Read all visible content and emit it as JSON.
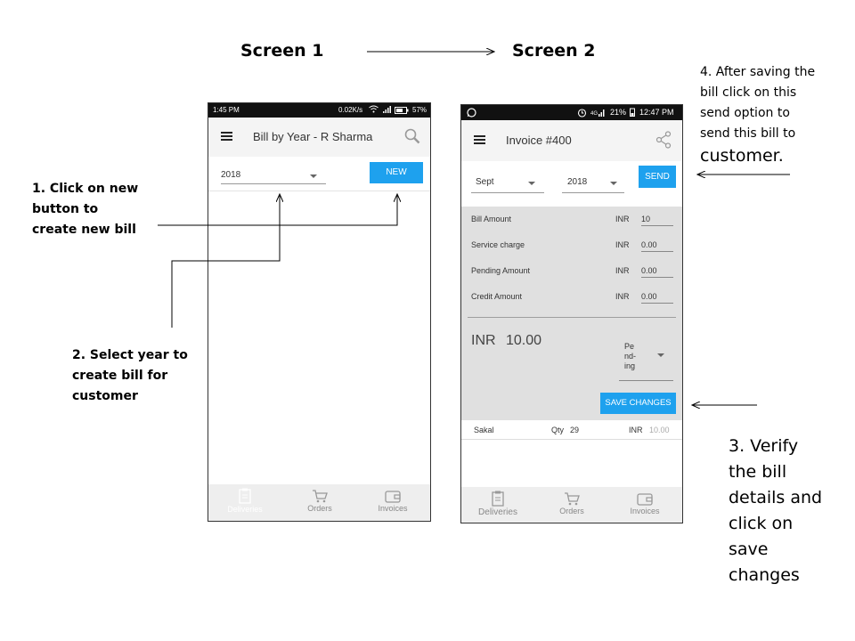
{
  "headings": {
    "screen1": "Screen 1",
    "screen2": "Screen 2"
  },
  "notes": {
    "step1": [
      "1. Click on new",
      "button to",
      "create new bill"
    ],
    "step2": [
      "2. Select year to",
      "create bill for",
      "customer"
    ],
    "step3": [
      "3. Verify",
      "the bill",
      "details and",
      "click on",
      "save",
      "changes"
    ],
    "step4": [
      "4. After saving the",
      "bill click on this",
      "send option to",
      "send this bill to"
    ],
    "step4_last": "customer."
  },
  "screen1": {
    "status": {
      "time": "1:45 PM",
      "speed": "0.02K/s",
      "battery": "57%"
    },
    "title": "Bill by Year - R Sharma",
    "year": "2018",
    "new_label": "NEW",
    "nav": [
      "Deliveries",
      "Orders",
      "Invoices"
    ]
  },
  "screen2": {
    "status": {
      "battery": "21%",
      "time": "12:47 PM"
    },
    "title": "Invoice #400",
    "month": "Sept",
    "year": "2018",
    "send_label": "SEND",
    "rows": [
      {
        "label": "Bill Amount",
        "currency": "INR",
        "value": "10"
      },
      {
        "label": "Service charge",
        "currency": "INR",
        "value": "0.00"
      },
      {
        "label": "Pending Amount",
        "currency": "INR",
        "value": "0.00"
      },
      {
        "label": "Credit Amount",
        "currency": "INR",
        "value": "0.00"
      }
    ],
    "total_currency": "INR",
    "total_value": "10.00",
    "status_select": [
      "Pe",
      "nd-",
      "ing"
    ],
    "save_label": "SAVE CHANGES",
    "item": {
      "name": "Sakal",
      "qty_label": "Qty",
      "qty": "29",
      "currency": "INR",
      "amount": "10.00"
    },
    "nav": [
      "Deliveries",
      "Orders",
      "Invoices"
    ]
  },
  "colors": {
    "accent": "#1ea1ee",
    "panel": "#e0e0e0",
    "navbar": "#eeeeee"
  },
  "icons": [
    "menu-icon",
    "search-icon",
    "share-icon",
    "whatsapp-icon",
    "alarm-icon",
    "wifi-icon",
    "signal-icon",
    "battery-icon",
    "clipboard-icon",
    "cart-icon",
    "wallet-icon"
  ]
}
